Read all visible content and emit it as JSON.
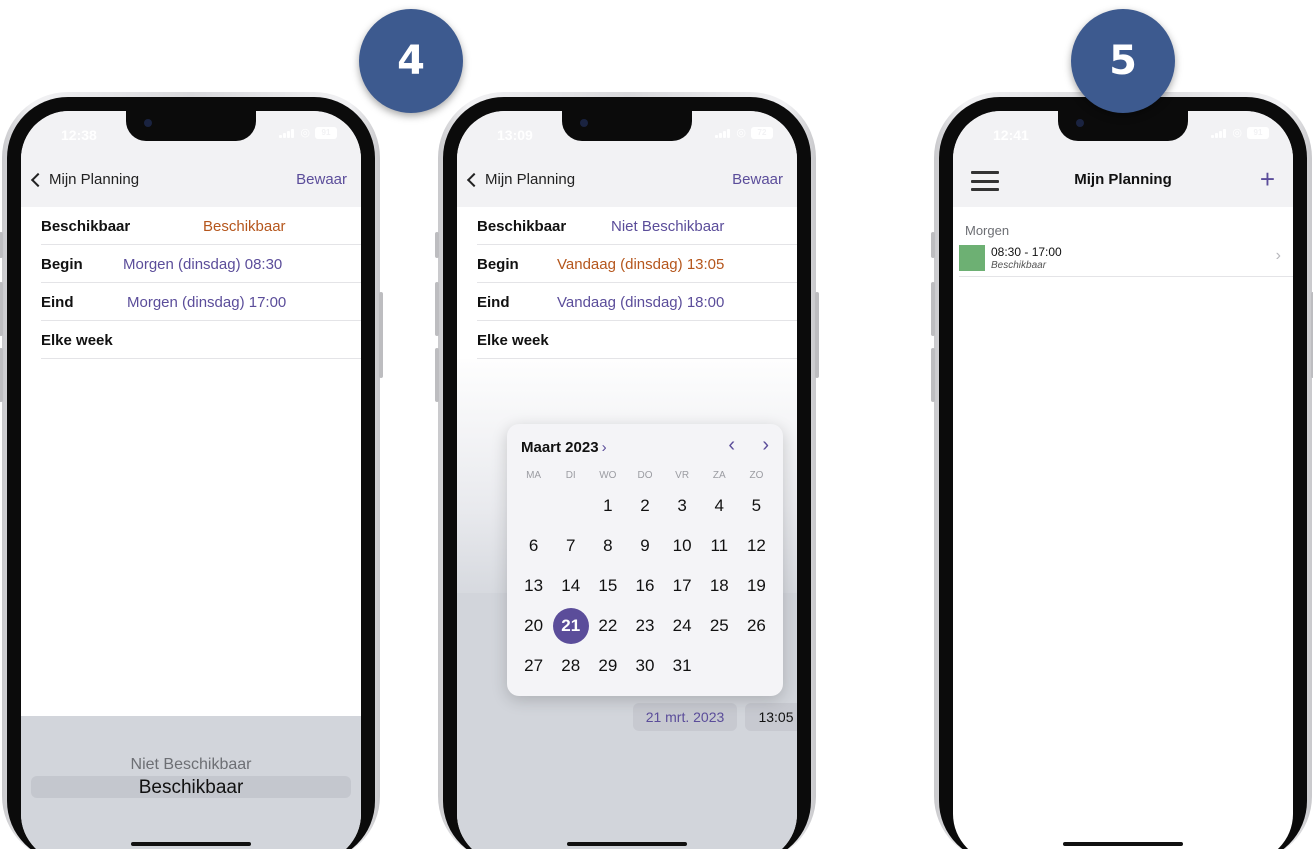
{
  "badges": {
    "left": "4",
    "right": "5"
  },
  "phone1": {
    "status_time": "12:38",
    "battery": "91",
    "nav": {
      "back_label": "Mijn Planning",
      "save_label": "Bewaar"
    },
    "rows": [
      {
        "label": "Beschikbaar",
        "value": "Beschikbaar",
        "color": "orange"
      },
      {
        "label": "Begin",
        "value": "Morgen (dinsdag) 08:30",
        "color": "purple"
      },
      {
        "label": "Eind",
        "value": "Morgen (dinsdag) 17:00",
        "color": "purple"
      },
      {
        "label": "Elke week",
        "value": ""
      }
    ],
    "picker": {
      "options": [
        "Niet Beschikbaar",
        "Beschikbaar"
      ],
      "selected": "Beschikbaar"
    }
  },
  "phone2": {
    "status_time": "13:09",
    "battery": "72",
    "nav": {
      "back_label": "Mijn Planning",
      "save_label": "Bewaar"
    },
    "rows": [
      {
        "label": "Beschikbaar",
        "value": "Niet Beschikbaar",
        "color": "purple"
      },
      {
        "label": "Begin",
        "value": "Vandaag (dinsdag) 13:05",
        "color": "orange"
      },
      {
        "label": "Eind",
        "value": "Vandaag (dinsdag) 18:00",
        "color": "purple"
      },
      {
        "label": "Elke week",
        "value": ""
      }
    ],
    "calendar": {
      "month_label": "Maart 2023",
      "weekdays": [
        "MA",
        "DI",
        "WO",
        "DO",
        "VR",
        "ZA",
        "ZO"
      ],
      "leading_blanks": 2,
      "days": 31,
      "selected_day": 21
    },
    "date_chip": "21 mrt. 2023",
    "time_chip": "13:05"
  },
  "phone3": {
    "status_time": "12:41",
    "battery": "91",
    "nav": {
      "title": "Mijn Planning"
    },
    "section": "Morgen",
    "items": [
      {
        "time": "08:30 - 17:00",
        "status": "Beschikbaar",
        "color": "#6db073"
      }
    ]
  },
  "colors": {
    "accent": "#5b4d9a",
    "orange": "#b5561c",
    "badge": "#3d5a8f"
  }
}
